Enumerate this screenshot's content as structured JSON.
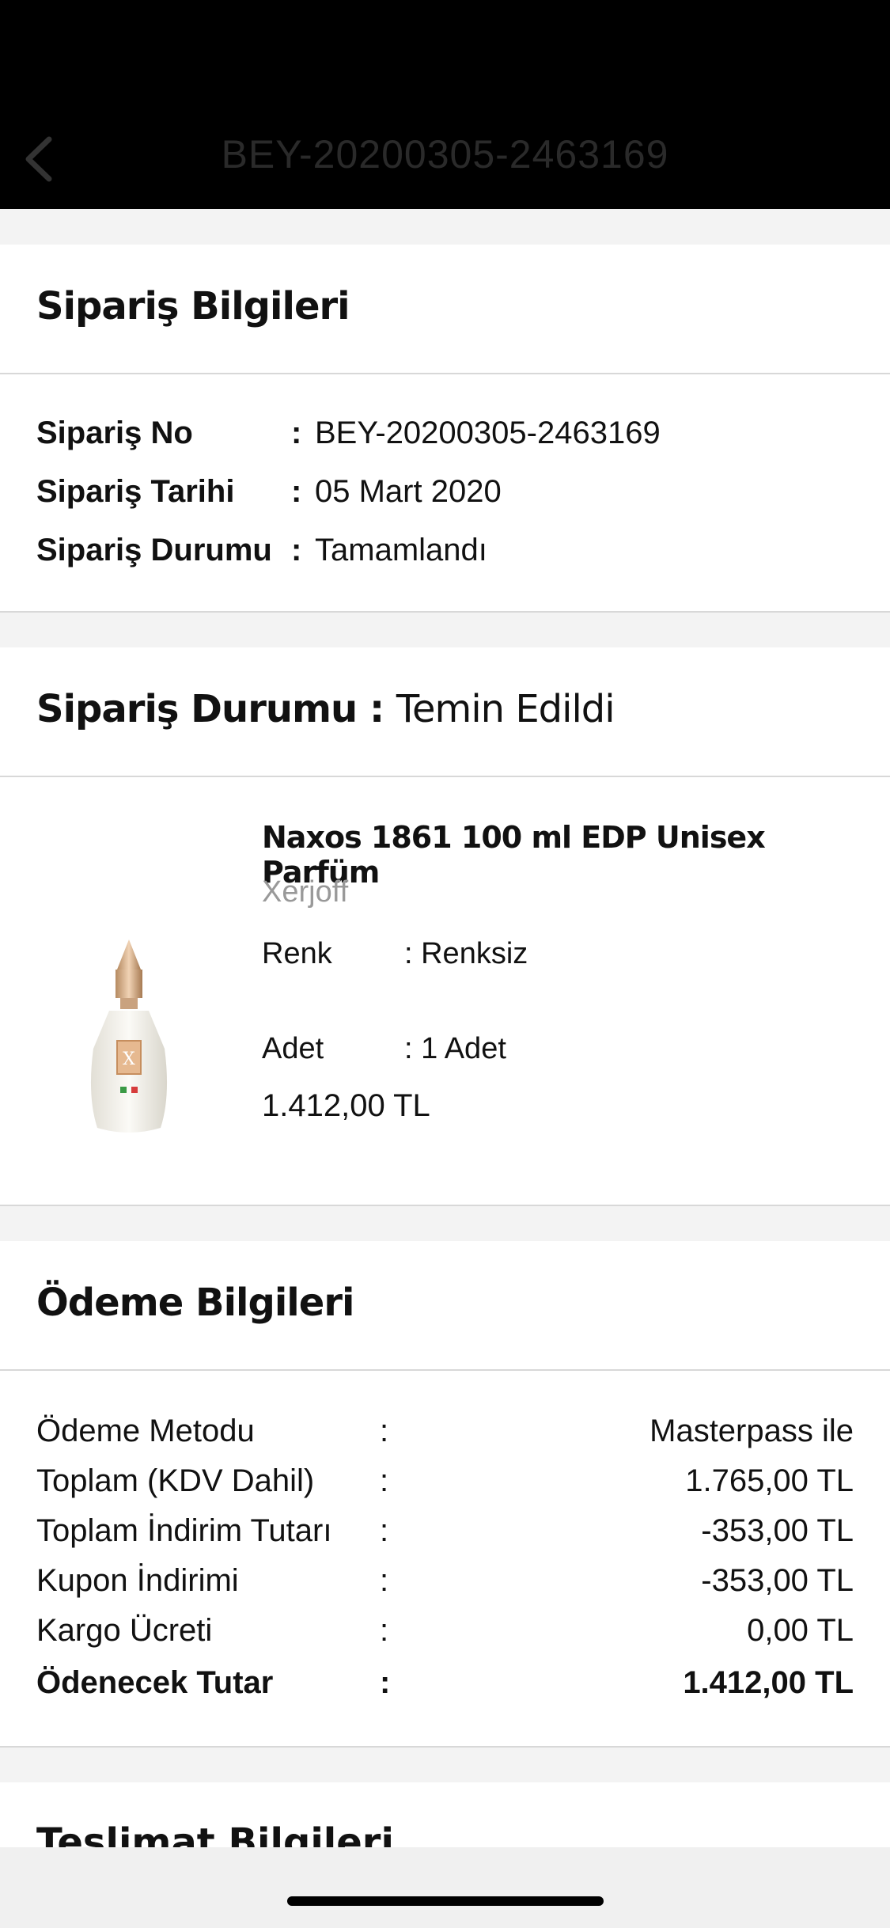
{
  "header": {
    "title": "BEY-20200305-2463169"
  },
  "order_info": {
    "heading": "Sipariş Bilgileri",
    "rows": [
      {
        "label": "Sipariş No",
        "value": "BEY-20200305-2463169"
      },
      {
        "label": "Sipariş Tarihi",
        "value": "05 Mart 2020"
      },
      {
        "label": "Sipariş Durumu",
        "value": "Tamamlandı"
      }
    ],
    "separator": ":"
  },
  "order_status": {
    "label": "Sipariş Durumu :",
    "value": "Temin Edildi"
  },
  "product": {
    "name": "Naxos 1861 100 ml EDP Unisex Parfüm",
    "brand": "Xerjoff",
    "color_label": "Renk",
    "color_value": ": Renksiz",
    "qty_label": "Adet",
    "qty_value": ": 1 Adet",
    "price": "1.412,00 TL"
  },
  "payment": {
    "heading": "Ödeme Bilgileri",
    "rows": [
      {
        "label": "Ödeme Metodu",
        "value": "Masterpass ile"
      },
      {
        "label": "Toplam (KDV Dahil)",
        "value": "1.765,00 TL"
      },
      {
        "label": "Toplam İndirim Tutarı",
        "value": "-353,00 TL"
      },
      {
        "label": "Kupon İndirimi",
        "value": "-353,00 TL"
      },
      {
        "label": "Kargo Ücreti",
        "value": "0,00 TL"
      },
      {
        "label": "Ödenecek Tutar",
        "value": "1.412,00 TL"
      }
    ],
    "separator": ":"
  },
  "delivery": {
    "heading": "Teslimat Bilgileri"
  },
  "colors": {
    "header_bg": "#000000",
    "page_bg": "#f3f3f3",
    "brand_text": "#999999"
  }
}
